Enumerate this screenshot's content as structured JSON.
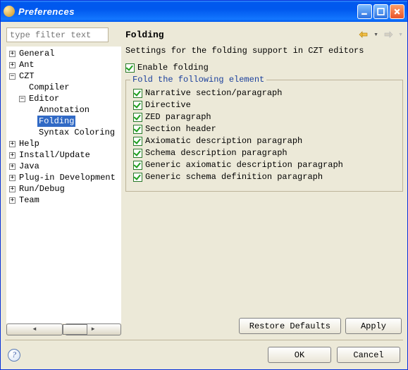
{
  "window": {
    "title": "Preferences"
  },
  "filter": {
    "placeholder": "type filter text"
  },
  "tree": {
    "items": {
      "general": "General",
      "ant": "Ant",
      "czt": "CZT",
      "compiler": "Compiler",
      "editor": "Editor",
      "annotation": "Annotation",
      "folding": "Folding",
      "syntax": "Syntax Coloring",
      "help": "Help",
      "install": "Install/Update",
      "java": "Java",
      "pde": "Plug-in Development",
      "run": "Run/Debug",
      "team": "Team"
    }
  },
  "page": {
    "title": "Folding",
    "description": "Settings for the folding support in CZT editors",
    "enable_label": "Enable folding",
    "group_legend": "Fold the following element",
    "options": [
      "Narrative section/paragraph",
      "Directive",
      "ZED paragraph",
      "Section header",
      "Axiomatic description paragraph",
      "Schema description paragraph",
      "Generic axiomatic description paragraph",
      "Generic schema definition paragraph"
    ],
    "restore": "Restore Defaults",
    "apply": "Apply"
  },
  "footer": {
    "ok": "OK",
    "cancel": "Cancel"
  }
}
